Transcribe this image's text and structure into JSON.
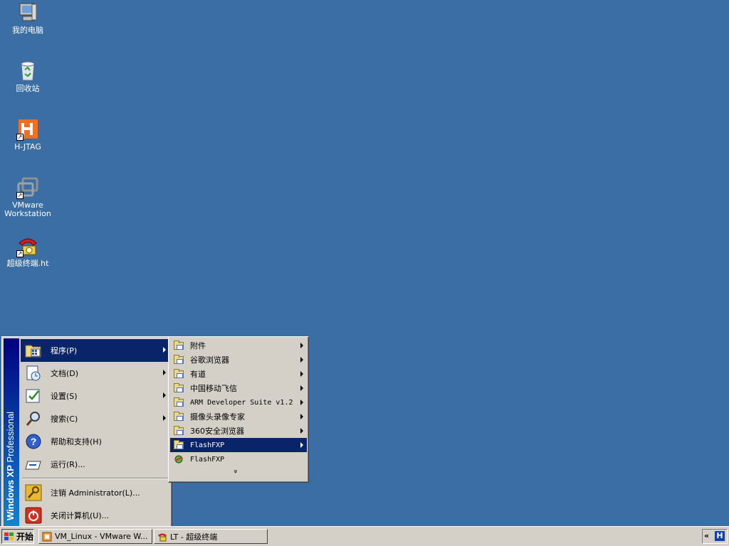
{
  "desktop": {
    "icons": [
      {
        "label": "我的电脑",
        "icon": "my-computer-icon"
      },
      {
        "label": "回收站",
        "icon": "recycle-bin-icon"
      },
      {
        "label": "H-JTAG",
        "icon": "h-jtag-icon"
      },
      {
        "label": "VMware\nWorkstation",
        "icon": "vmware-icon"
      },
      {
        "label": "超级终端.ht",
        "icon": "hyperterminal-icon"
      }
    ]
  },
  "start_menu": {
    "banner": {
      "brand": "Windows",
      "version": "XP",
      "edition": "Professional"
    },
    "items": [
      {
        "label": "程序(P)",
        "icon": "programs-icon",
        "submenu": true
      },
      {
        "label": "文档(D)",
        "icon": "documents-icon",
        "submenu": true
      },
      {
        "label": "设置(S)",
        "icon": "settings-icon",
        "submenu": true
      },
      {
        "label": "搜索(C)",
        "icon": "search-icon",
        "submenu": true
      },
      {
        "label": "帮助和支持(H)",
        "icon": "help-icon",
        "submenu": false
      },
      {
        "label": "运行(R)...",
        "icon": "run-icon",
        "submenu": false
      },
      {
        "label": "注销 Administrator(L)...",
        "icon": "logoff-icon",
        "submenu": false
      },
      {
        "label": "关闭计算机(U)...",
        "icon": "shutdown-icon",
        "submenu": false
      }
    ]
  },
  "programs_submenu": {
    "items": [
      {
        "label": "附件",
        "icon": "folder-icon",
        "submenu": true
      },
      {
        "label": "谷歌浏览器",
        "icon": "folder-icon",
        "submenu": true
      },
      {
        "label": "有道",
        "icon": "folder-icon",
        "submenu": true
      },
      {
        "label": "中国移动飞信",
        "icon": "folder-icon",
        "submenu": true
      },
      {
        "label": "ARM Developer Suite v1.2",
        "icon": "folder-icon",
        "submenu": true
      },
      {
        "label": "摄像头录像专家",
        "icon": "folder-icon",
        "submenu": true
      },
      {
        "label": "360安全浏览器",
        "icon": "folder-icon",
        "submenu": true
      },
      {
        "label": "FlashFXP",
        "icon": "folder-icon",
        "submenu": true
      },
      {
        "label": "FlashFXP",
        "icon": "flashfxp-icon",
        "submenu": false
      }
    ],
    "expand_glyph": "»"
  },
  "taskbar": {
    "start_label": "开始",
    "buttons": [
      {
        "label": "VM_Linux - VMware W...",
        "icon": "vmware-icon"
      },
      {
        "label": "LT - 超级终端",
        "icon": "hyperterminal-icon"
      }
    ],
    "tray": {
      "chevron": "«",
      "app_icon": "H"
    }
  },
  "colors": {
    "desktop": "#3a6ea5",
    "menu_face": "#d4d0c8",
    "selection": "#0a246a"
  }
}
